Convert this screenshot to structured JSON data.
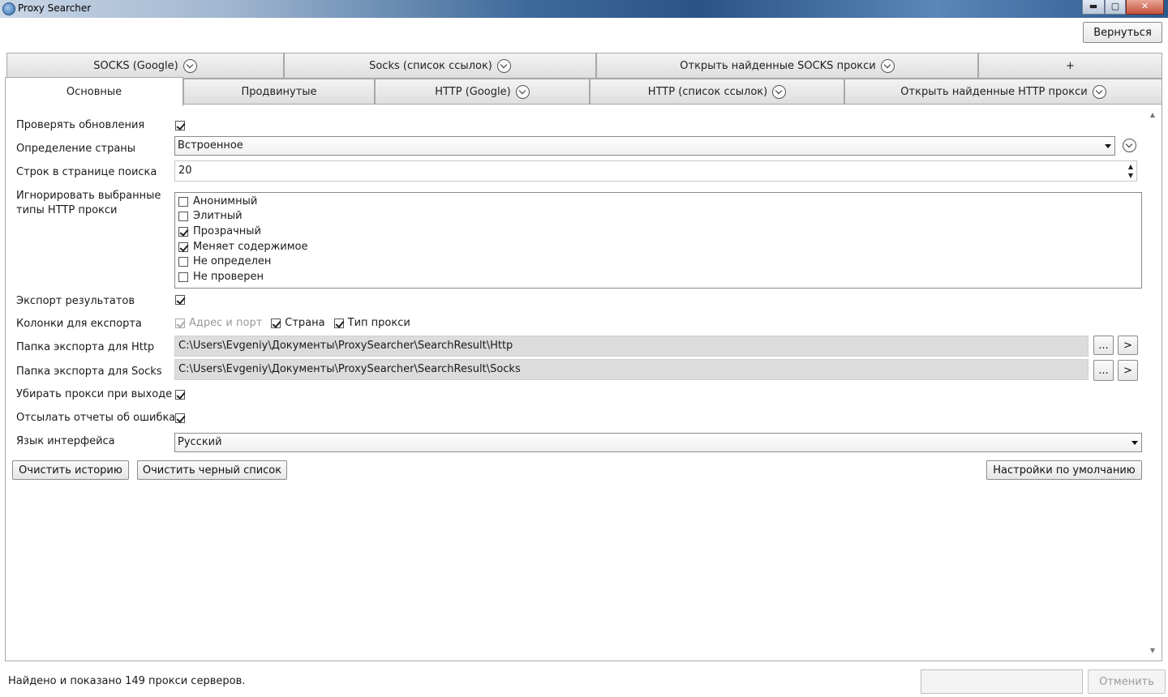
{
  "window": {
    "title": "Proxy Searcher"
  },
  "header": {
    "back_button": "Вернуться"
  },
  "tabs_row1": [
    {
      "label": "SOCKS (Google)",
      "chevron": true
    },
    {
      "label": "Socks (список ссылок)",
      "chevron": true
    },
    {
      "label": "Открыть найденные SOCKS прокси",
      "chevron": true
    },
    {
      "label": "+",
      "chevron": false
    }
  ],
  "tabs_row2": [
    {
      "label": "Основные",
      "chevron": false,
      "active": true
    },
    {
      "label": "Продвинутые",
      "chevron": false
    },
    {
      "label": "HTTP (Google)",
      "chevron": true
    },
    {
      "label": "HTTP (список ссылок)",
      "chevron": true
    },
    {
      "label": "Открыть найденные HTTP прокси",
      "chevron": true
    }
  ],
  "settings": {
    "check_updates": {
      "label": "Проверять обновления",
      "checked": true
    },
    "country_detection": {
      "label": "Определение страны",
      "value": "Встроенное"
    },
    "rows_per_page": {
      "label": "Строк в странице поиска",
      "value": "20"
    },
    "ignore_types": {
      "label": "Игнорировать выбранные типы HTTP прокси",
      "items": [
        {
          "label": "Анонимный",
          "checked": false
        },
        {
          "label": "Элитный",
          "checked": false
        },
        {
          "label": "Прозрачный",
          "checked": true
        },
        {
          "label": "Меняет содержимое",
          "checked": true
        },
        {
          "label": "Не определен",
          "checked": false
        },
        {
          "label": "Не проверен",
          "checked": false
        }
      ]
    },
    "export_results": {
      "label": "Экспорт результатов",
      "checked": true
    },
    "export_columns": {
      "label": "Колонки для експорта",
      "address_port": "Адрес и порт",
      "country": "Страна",
      "proxy_type": "Тип прокси"
    },
    "http_folder": {
      "label": "Папка экспорта для Http",
      "value": "C:\\Users\\Evgeniy\\Документы\\ProxySearcher\\SearchResult\\Http"
    },
    "socks_folder": {
      "label": "Папка экспорта для Socks",
      "value": "C:\\Users\\Evgeniy\\Документы\\ProxySearcher\\SearchResult\\Socks"
    },
    "browse_label": "...",
    "open_label": ">",
    "remove_on_exit": {
      "label": "Убирать прокси при выходе",
      "checked": true
    },
    "send_reports": {
      "label": "Отсылать отчеты об ошибках",
      "checked": true
    },
    "language": {
      "label": "Язык интерфейса",
      "value": "Русский"
    }
  },
  "actions": {
    "clear_history": "Очистить историю",
    "clear_blacklist": "Очистить черный список",
    "defaults": "Настройки по умолчанию"
  },
  "status": {
    "text": "Найдено и показано 149 прокси серверов.",
    "cancel": "Отменить"
  }
}
